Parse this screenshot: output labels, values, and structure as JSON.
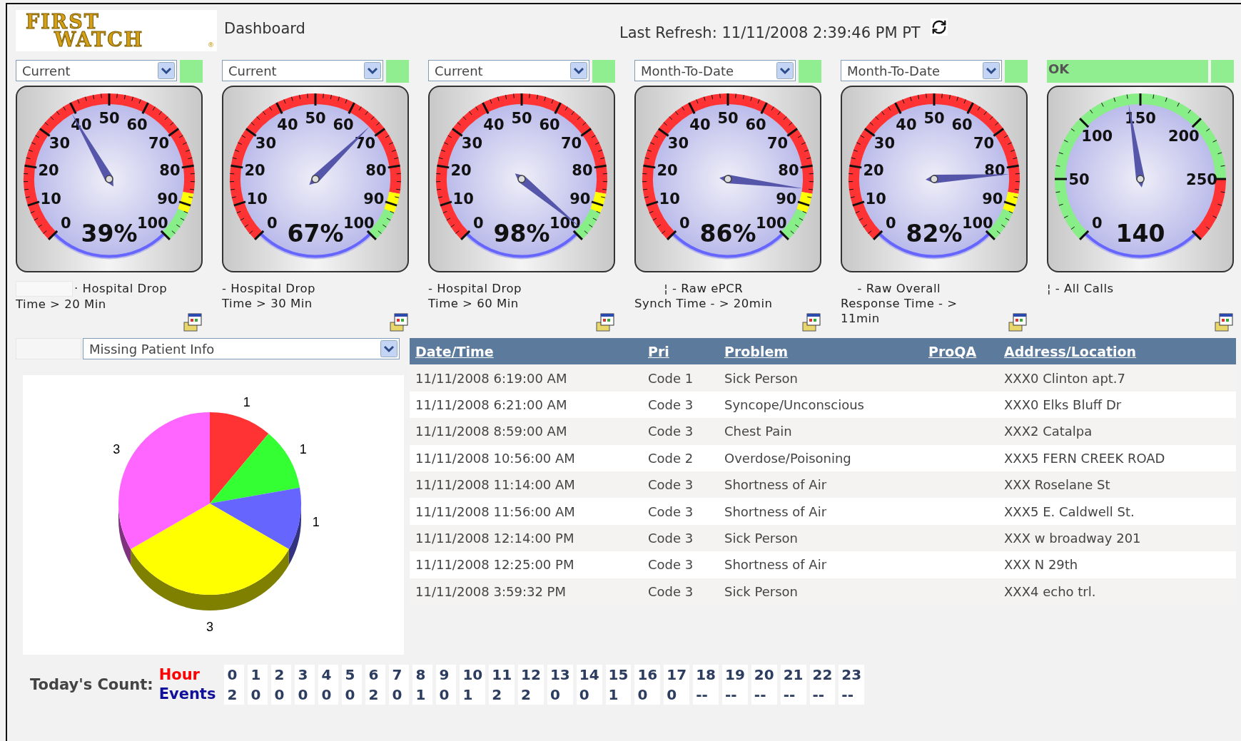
{
  "header": {
    "logo": [
      "FIRST",
      "WATCH"
    ],
    "logo_mark": "®",
    "title": "Dashboard",
    "last_refresh": "Last Refresh: 11/11/2008 2:39:46 PM PT"
  },
  "gauges": [
    {
      "kind": "percent",
      "period": "Current",
      "ticks": [
        "0",
        "10",
        "20",
        "30",
        "40",
        "50",
        "60",
        "70",
        "80",
        "90",
        "100"
      ],
      "reading": "39%",
      "caption": [
        "· Hospital Drop",
        "Time > 20 Min"
      ]
    },
    {
      "kind": "percent",
      "period": "Current",
      "ticks": [
        "0",
        "10",
        "20",
        "30",
        "40",
        "50",
        "60",
        "70",
        "80",
        "90",
        "100"
      ],
      "reading": "67%",
      "caption": [
        "- Hospital Drop",
        "Time > 30 Min"
      ]
    },
    {
      "kind": "percent",
      "period": "Current",
      "ticks": [
        "0",
        "10",
        "20",
        "30",
        "40",
        "50",
        "60",
        "70",
        "80",
        "90",
        "100"
      ],
      "reading": "98%",
      "caption": [
        "- Hospital Drop",
        "Time > 60 Min"
      ]
    },
    {
      "kind": "percent",
      "period": "Month-To-Date",
      "ticks": [
        "0",
        "10",
        "20",
        "30",
        "40",
        "50",
        "60",
        "70",
        "80",
        "90",
        "100"
      ],
      "reading": "86%",
      "caption": [
        "¦ - Raw ePCR",
        "Synch Time - > 20min"
      ]
    },
    {
      "kind": "percent",
      "period": "Month-To-Date",
      "ticks": [
        "0",
        "10",
        "20",
        "30",
        "40",
        "50",
        "60",
        "70",
        "80",
        "90",
        "100"
      ],
      "reading": "82%",
      "caption": [
        "- Raw Overall",
        "Response Time - >",
        "11min"
      ]
    },
    {
      "kind": "count",
      "status": "OK",
      "ticks": [
        "0",
        "50",
        "100",
        "150",
        "200",
        "250"
      ],
      "reading": "140",
      "caption": [
        "¦ - All Calls"
      ]
    }
  ],
  "report_selector": {
    "value": "Missing Patient Info"
  },
  "chart_data": {
    "type": "pie",
    "values": [
      1,
      1,
      1,
      3,
      3
    ],
    "colors": [
      "#ff3333",
      "#33ff33",
      "#6666ff",
      "#ffff00",
      "#ff66ff"
    ],
    "data_labels": true
  },
  "table": {
    "columns": [
      "Date/Time",
      "Pri",
      "Problem",
      "ProQA",
      "Address/Location"
    ],
    "rows": [
      {
        "date_time": "11/11/2008 6:19:00 AM",
        "pri": "Code 1",
        "problem": "Sick Person",
        "address": "XXX0 Clinton apt.7"
      },
      {
        "date_time": "11/11/2008 6:21:00 AM",
        "pri": "Code 3",
        "problem": "Syncope/Unconscious",
        "address": "XXX0 Elks Bluff Dr"
      },
      {
        "date_time": "11/11/2008 8:59:00 AM",
        "pri": "Code 3",
        "problem": "Chest Pain",
        "address": "XXX2 Catalpa"
      },
      {
        "date_time": "11/11/2008 10:56:00 AM",
        "pri": "Code 2",
        "problem": "Overdose/Poisoning",
        "address": "XXX5 FERN CREEK ROAD"
      },
      {
        "date_time": "11/11/2008 11:14:00 AM",
        "pri": "Code 3",
        "problem": "Shortness of Air",
        "address": "XXX Roselane St"
      },
      {
        "date_time": "11/11/2008 11:56:00 AM",
        "pri": "Code 3",
        "problem": "Shortness of Air",
        "address": "XXX5 E. Caldwell St."
      },
      {
        "date_time": "11/11/2008 12:14:00 PM",
        "pri": "Code 3",
        "problem": "Sick Person",
        "address": "XXX w broadway 201"
      },
      {
        "date_time": "11/11/2008 12:25:00 PM",
        "pri": "Code 3",
        "problem": "Shortness of Air",
        "address": "XXX N 29th"
      },
      {
        "date_time": "11/11/2008 3:59:32 PM",
        "pri": "Code 3",
        "problem": "Sick Person",
        "address": "XXX4 echo trl."
      }
    ]
  },
  "todays_count": {
    "label": "Today's Count:",
    "hour_label": "Hour",
    "events_label": "Events",
    "hours": [
      "0",
      "1",
      "2",
      "3",
      "4",
      "5",
      "6",
      "7",
      "8",
      "9",
      "10",
      "11",
      "12",
      "13",
      "14",
      "15",
      "16",
      "17",
      "18",
      "19",
      "20",
      "21",
      "22",
      "23"
    ],
    "events": [
      "2",
      "0",
      "0",
      "0",
      "0",
      "0",
      "2",
      "0",
      "1",
      "0",
      "1",
      "2",
      "2",
      "0",
      "0",
      "1",
      "0",
      "0",
      "--",
      "--",
      "--",
      "--",
      "--",
      "--"
    ]
  }
}
